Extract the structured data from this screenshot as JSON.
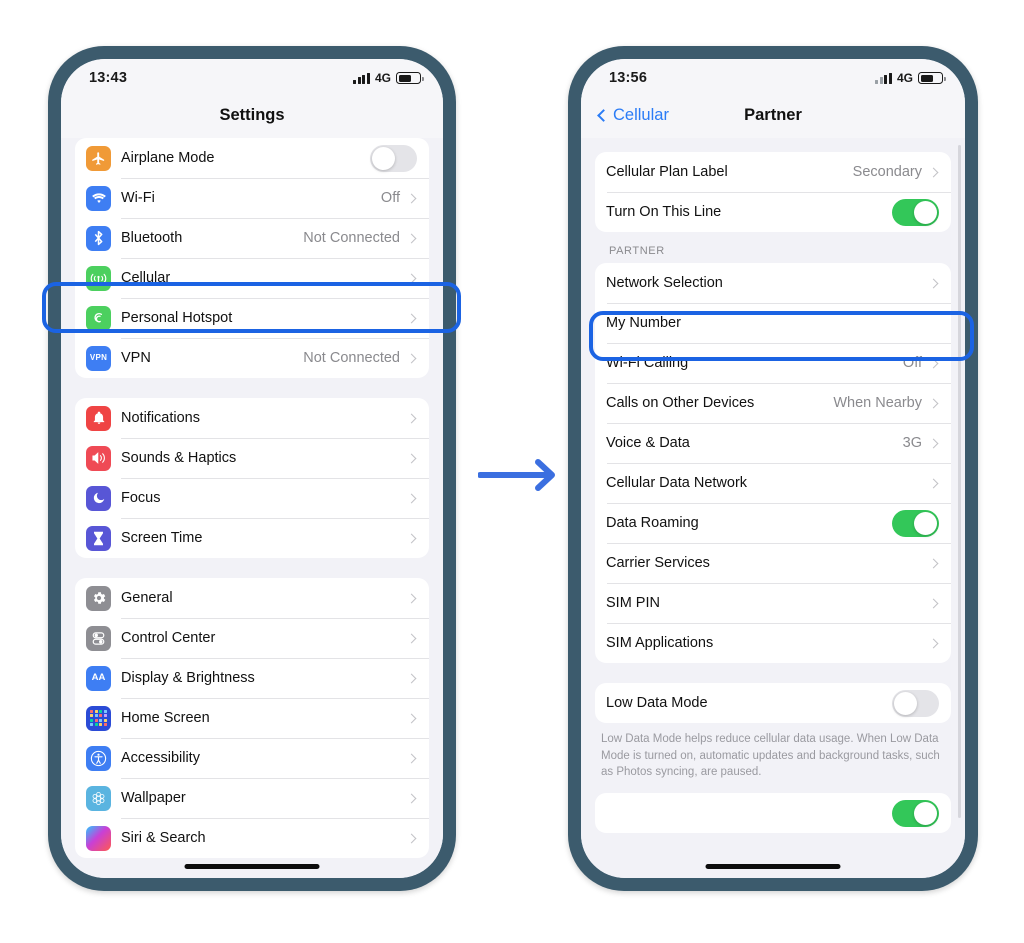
{
  "left_phone": {
    "status_bar": {
      "time": "13:43",
      "network": "4G",
      "signal_icon": "signal-bars-icon",
      "battery_icon": "battery-icon"
    },
    "nav": {
      "title": "Settings"
    },
    "groups": [
      {
        "rows": [
          {
            "label": "Airplane Mode",
            "icon": "airplane-icon",
            "icon_color": "#f09a37",
            "control": "toggle",
            "toggle_on": false
          },
          {
            "label": "Wi-Fi",
            "icon": "wifi-icon",
            "icon_color": "#3e7ef3",
            "value": "Off",
            "control": "chevron"
          },
          {
            "label": "Bluetooth",
            "icon": "bluetooth-icon",
            "icon_color": "#3e7ef3",
            "value": "Not Connected",
            "control": "chevron"
          },
          {
            "label": "Cellular",
            "icon": "cellular-icon",
            "icon_color": "#4cd05f",
            "value": "",
            "control": "chevron",
            "highlighted": true
          },
          {
            "label": "Personal Hotspot",
            "icon": "hotspot-icon",
            "icon_color": "#4cd05f",
            "value": "",
            "control": "chevron"
          },
          {
            "label": "VPN",
            "icon": "vpn-icon",
            "icon_color": "#3e7ef3",
            "value": "Not Connected",
            "control": "chevron"
          }
        ]
      },
      {
        "rows": [
          {
            "label": "Notifications",
            "icon": "notifications-icon",
            "icon_color": "#ef4444",
            "control": "chevron"
          },
          {
            "label": "Sounds & Haptics",
            "icon": "sounds-icon",
            "icon_color": "#ef4a55",
            "control": "chevron"
          },
          {
            "label": "Focus",
            "icon": "focus-icon",
            "icon_color": "#5856d6",
            "control": "chevron"
          },
          {
            "label": "Screen Time",
            "icon": "screen-time-icon",
            "icon_color": "#5856d6",
            "control": "chevron"
          }
        ]
      },
      {
        "rows": [
          {
            "label": "General",
            "icon": "gear-icon",
            "icon_color": "#8e8e93",
            "control": "chevron"
          },
          {
            "label": "Control Center",
            "icon": "control-center-icon",
            "icon_color": "#8e8e93",
            "control": "chevron"
          },
          {
            "label": "Display & Brightness",
            "icon": "display-brightness-icon",
            "icon_color": "#3e7ef3",
            "control": "chevron"
          },
          {
            "label": "Home Screen",
            "icon": "home-screen-icon",
            "icon_color": "#2b4bd6",
            "control": "chevron"
          },
          {
            "label": "Accessibility",
            "icon": "accessibility-icon",
            "icon_color": "#3e7ef3",
            "control": "chevron"
          },
          {
            "label": "Wallpaper",
            "icon": "wallpaper-icon",
            "icon_color": "#5ab4e0",
            "control": "chevron"
          },
          {
            "label": "Siri & Search",
            "icon": "siri-icon",
            "icon_color": "#2d2d35",
            "control": "chevron"
          }
        ]
      }
    ]
  },
  "right_phone": {
    "status_bar": {
      "time": "13:56",
      "network": "4G",
      "signal_icon": "signal-bars-icon",
      "battery_icon": "battery-icon"
    },
    "nav": {
      "back_label": "Cellular",
      "title": "Partner"
    },
    "group1": [
      {
        "label": "Cellular Plan Label",
        "value": "Secondary",
        "control": "chevron"
      },
      {
        "label": "Turn On This Line",
        "control": "toggle",
        "toggle_on": true
      }
    ],
    "section_header": "PARTNER",
    "group2": [
      {
        "label": "Network Selection",
        "value": "",
        "control": "chevron",
        "highlighted": true
      },
      {
        "label": "My Number",
        "value": "",
        "control": "none"
      },
      {
        "label": "Wi-Fi Calling",
        "value": "Off",
        "control": "chevron"
      },
      {
        "label": "Calls on Other Devices",
        "value": "When Nearby",
        "control": "chevron"
      },
      {
        "label": "Voice & Data",
        "value": "3G",
        "control": "chevron"
      },
      {
        "label": "Cellular Data Network",
        "value": "",
        "control": "chevron"
      },
      {
        "label": "Data Roaming",
        "control": "toggle",
        "toggle_on": true
      },
      {
        "label": "Carrier Services",
        "value": "",
        "control": "chevron"
      },
      {
        "label": "SIM PIN",
        "value": "",
        "control": "chevron"
      },
      {
        "label": "SIM Applications",
        "value": "",
        "control": "chevron"
      }
    ],
    "group3": [
      {
        "label": "Low Data Mode",
        "control": "toggle",
        "toggle_on": false
      }
    ],
    "footnote": "Low Data Mode helps reduce cellular data usage. When Low Data Mode is turned on, automatic updates and background tasks, such as Photos syncing, are paused.",
    "partial_row": {
      "control": "toggle",
      "toggle_on": true
    }
  },
  "flow_arrow": {
    "name": "right-arrow",
    "color": "#3b6fe0"
  }
}
